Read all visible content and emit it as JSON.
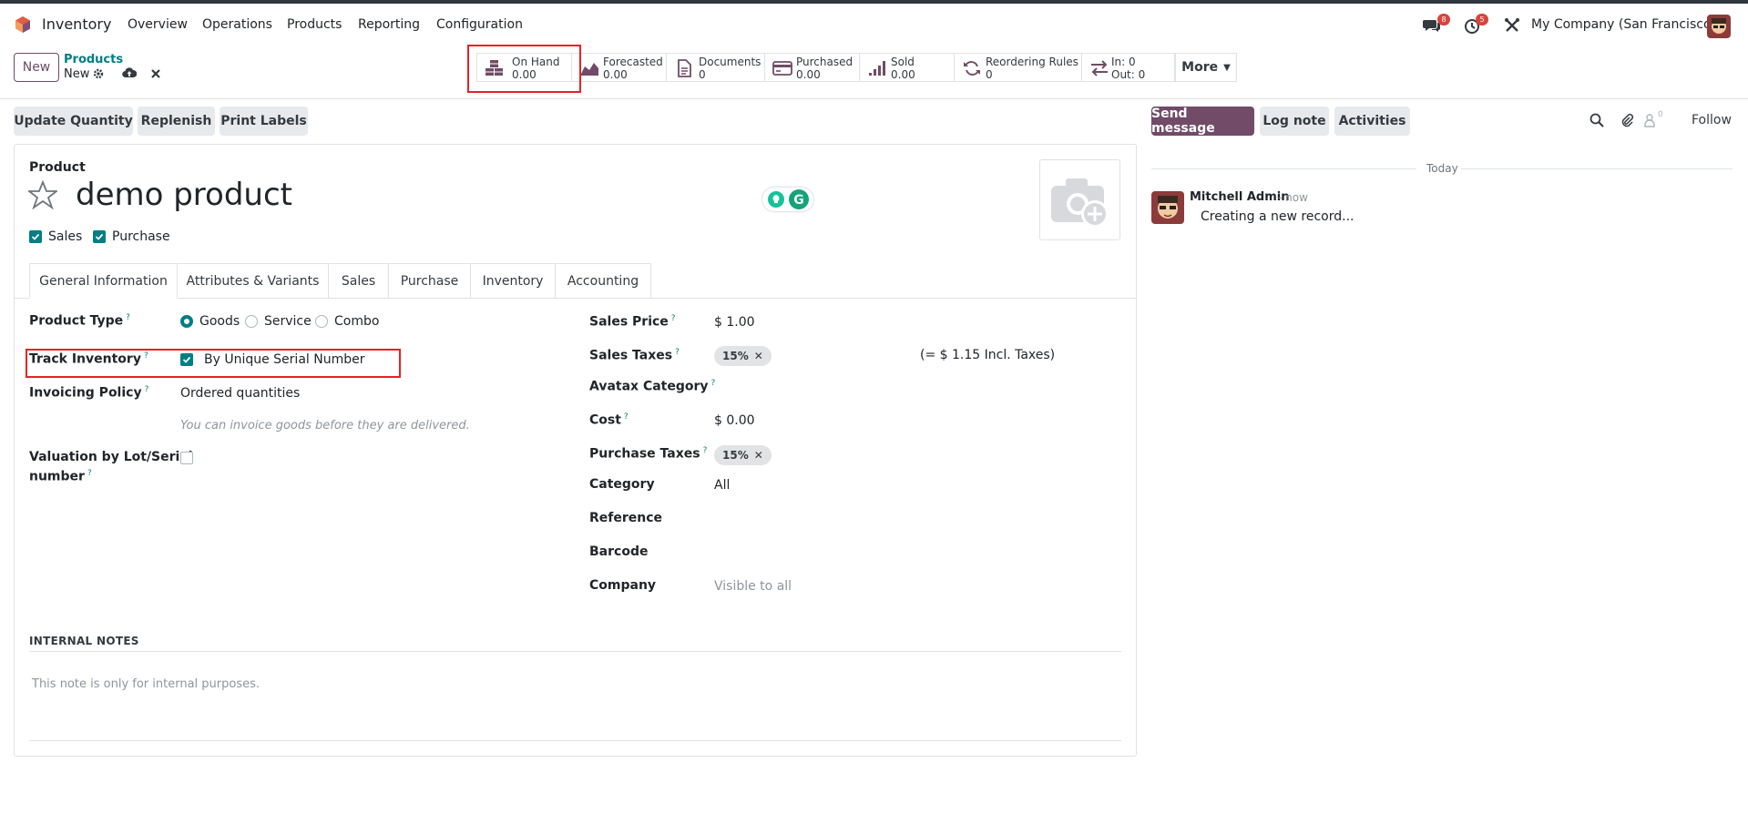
{
  "navbar": {
    "app_name": "Inventory",
    "menu": [
      "Overview",
      "Operations",
      "Products",
      "Reporting",
      "Configuration"
    ],
    "messages_badge": "8",
    "activities_badge": "5",
    "company": "My Company (San Francisco)"
  },
  "control_panel": {
    "new_label": "New",
    "breadcrumb_parent": "Products",
    "breadcrumb_current": "New",
    "more_label": "More"
  },
  "smart_buttons": [
    {
      "label": "On Hand",
      "value": "0.00",
      "icon": "cubes-icon"
    },
    {
      "label": "Forecasted",
      "value": "0.00",
      "icon": "area-chart-icon"
    },
    {
      "label": "Documents",
      "value": "0",
      "icon": "file-icon"
    },
    {
      "label": "Purchased",
      "value": "0.00",
      "icon": "credit-card-icon"
    },
    {
      "label": "Sold",
      "value": "0.00",
      "icon": "signal-icon"
    },
    {
      "label": "Reordering Rules",
      "value": "0",
      "icon": "refresh-icon"
    },
    {
      "label": "In: 0",
      "value": "Out: 0",
      "icon": "exchange-icon"
    }
  ],
  "actions": [
    "Update Quantity",
    "Replenish",
    "Print Labels"
  ],
  "chatter": {
    "send_message": "Send message",
    "log_note": "Log note",
    "activities": "Activities",
    "followers_count": "0",
    "follow": "Follow",
    "date_separator": "Today",
    "message": {
      "author": "Mitchell Admin",
      "time": "- now",
      "body": "Creating a new record..."
    }
  },
  "form": {
    "product_label": "Product",
    "product_name": "demo product",
    "can_be_sold": "Sales",
    "can_be_purchased": "Purchase",
    "tabs": [
      "General Information",
      "Attributes & Variants",
      "Sales",
      "Purchase",
      "Inventory",
      "Accounting"
    ],
    "left": {
      "product_type_label": "Product Type",
      "product_type_options": [
        "Goods",
        "Service",
        "Combo"
      ],
      "product_type_selected": "Goods",
      "track_inventory_label": "Track Inventory",
      "track_inventory_value": "By Unique Serial Number",
      "invoicing_policy_label": "Invoicing Policy",
      "invoicing_policy_value": "Ordered quantities",
      "invoicing_hint": "You can invoice goods before they are delivered.",
      "valuation_label_1": "Valuation by Lot/Serial",
      "valuation_label_2": "number"
    },
    "right": {
      "sales_price_label": "Sales Price",
      "sales_price_value": "$ 1.00",
      "sales_taxes_label": "Sales Taxes",
      "sales_tax_tag": "15%",
      "incl_taxes": "(= $ 1.15 Incl. Taxes)",
      "avatax_label": "Avatax Category",
      "cost_label": "Cost",
      "cost_value": "$ 0.00",
      "purchase_taxes_label": "Purchase Taxes",
      "purchase_tax_tag": "15%",
      "category_label": "Category",
      "category_value": "All",
      "reference_label": "Reference",
      "barcode_label": "Barcode",
      "company_label": "Company",
      "company_value": "Visible to all"
    },
    "internal_notes_title": "INTERNAL NOTES",
    "internal_notes_placeholder": "This note is only for internal purposes."
  },
  "colors": {
    "brand": "#714b67",
    "accent": "#017e84",
    "highlight": "#e8202a"
  }
}
